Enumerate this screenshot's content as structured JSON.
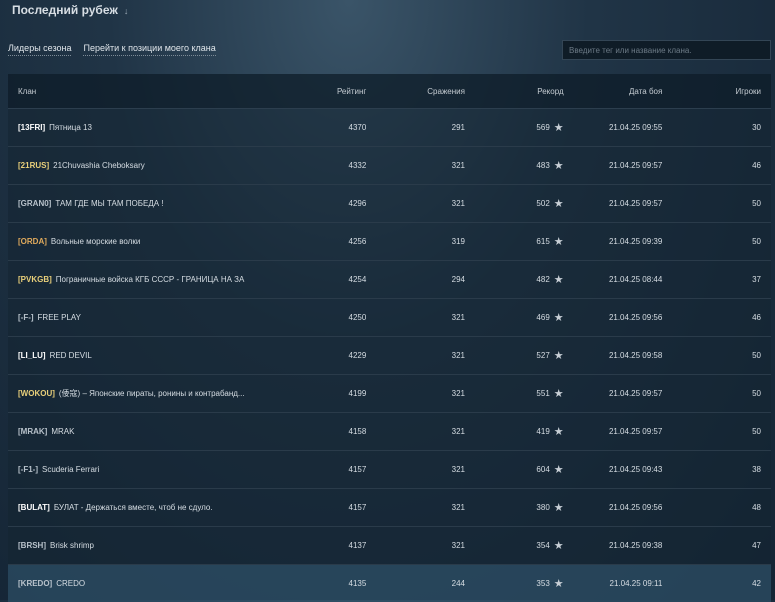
{
  "header": {
    "title": "Последний рубеж"
  },
  "links": {
    "leaders": "Лидеры сезона",
    "goto": "Перейти к позиции моего клана"
  },
  "search": {
    "placeholder": "Введите тег или название клана."
  },
  "table": {
    "headers": {
      "clan": "Клан",
      "rating": "Рейтинг",
      "battles": "Сражения",
      "record": "Рекорд",
      "date": "Дата боя",
      "players": "Игроки"
    },
    "rows": [
      {
        "tag": "[13FRI]",
        "tag_color": "#ffffff",
        "name": "Пятница 13",
        "rating": "4370",
        "battles": "291",
        "record": "569",
        "date": "21.04.25 09:55",
        "players": "30"
      },
      {
        "tag": "[21RUS]",
        "tag_color": "#e8cf7a",
        "name": "21Chuvashia Cheboksary",
        "rating": "4332",
        "battles": "321",
        "record": "483",
        "date": "21.04.25 09:57",
        "players": "46"
      },
      {
        "tag": "[GRAN0]",
        "tag_color": "#b8c2cb",
        "name": "ТАМ ГДЕ МЫ ТАМ ПОБЕДА !",
        "rating": "4296",
        "battles": "321",
        "record": "502",
        "date": "21.04.25 09:57",
        "players": "50"
      },
      {
        "tag": "[ORDA]",
        "tag_color": "#e0aa5c",
        "name": "Вольные морские волки",
        "rating": "4256",
        "battles": "319",
        "record": "615",
        "date": "21.04.25 09:39",
        "players": "50"
      },
      {
        "tag": "[PVKGB]",
        "tag_color": "#e8cf7a",
        "name": "Пограничные войска КГБ СССР - ГРАНИЦА НА ЗА...",
        "rating": "4254",
        "battles": "294",
        "record": "482",
        "date": "21.04.25 08:44",
        "players": "37"
      },
      {
        "tag": "[-F-]",
        "tag_color": "#b8c2cb",
        "name": "FREE PLAY",
        "rating": "4250",
        "battles": "321",
        "record": "469",
        "date": "21.04.25 09:56",
        "players": "46"
      },
      {
        "tag": "[LI_LU]",
        "tag_color": "#ffffff",
        "name": "RED DEVIL",
        "rating": "4229",
        "battles": "321",
        "record": "527",
        "date": "21.04.25 09:58",
        "players": "50"
      },
      {
        "tag": "[WOKOU]",
        "tag_color": "#e8cf7a",
        "name": "(倭寇) – Японские пираты, ронины и контрабанд...",
        "rating": "4199",
        "battles": "321",
        "record": "551",
        "date": "21.04.25 09:57",
        "players": "50"
      },
      {
        "tag": "[MRAK]",
        "tag_color": "#b8c2cb",
        "name": "MRAK",
        "rating": "4158",
        "battles": "321",
        "record": "419",
        "date": "21.04.25 09:57",
        "players": "50"
      },
      {
        "tag": "[-F1-]",
        "tag_color": "#b8c2cb",
        "name": "Scuderia Ferrari",
        "rating": "4157",
        "battles": "321",
        "record": "604",
        "date": "21.04.25 09:43",
        "players": "38"
      },
      {
        "tag": "[BULAT]",
        "tag_color": "#ffffff",
        "name": "БУЛАТ - Держаться вместе, чтоб не сдуло.",
        "rating": "4157",
        "battles": "321",
        "record": "380",
        "date": "21.04.25 09:56",
        "players": "48"
      },
      {
        "tag": "[BRSH]",
        "tag_color": "#b8c2cb",
        "name": "Brisk shrimp",
        "rating": "4137",
        "battles": "321",
        "record": "354",
        "date": "21.04.25 09:38",
        "players": "47"
      },
      {
        "tag": "[KREDO]",
        "tag_color": "#b8c2cb",
        "name": "CREDO",
        "rating": "4135",
        "battles": "244",
        "record": "353",
        "date": "21.04.25 09:11",
        "players": "42"
      }
    ]
  }
}
